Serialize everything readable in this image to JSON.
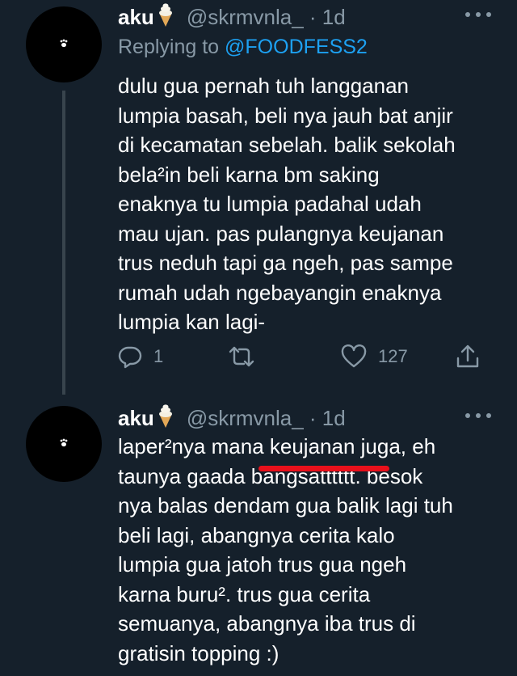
{
  "tweets": [
    {
      "name": "aku",
      "handle": "@skrmvnla_",
      "time": "· 1d",
      "replying_label": "Replying to ",
      "replying_handle": "@FOODFESS2",
      "lines": [
        "dulu gua pernah tuh langganan",
        "lumpia basah, beli nya jauh bat anjir",
        "di kecamatan sebelah. balik sekolah",
        "bela²in beli karna bm saking",
        "enaknya tu lumpia padahal udah",
        "mau ujan. pas pulangnya keujanan",
        "trus neduh tapi ga ngeh, pas sampe",
        "rumah udah ngebayangin enaknya",
        "lumpia kan lagi-"
      ],
      "reply_count": "1",
      "retweet_count": "",
      "like_count": "127"
    },
    {
      "name": "aku",
      "handle": "@skrmvnla_",
      "time": "· 1d",
      "lines": [
        "laper²nya mana keujanan juga, eh",
        "taunya gaada bangsatttttt. besok",
        "nya balas dendam gua balik lagi tuh",
        "beli lagi, abangnya cerita kalo",
        "lumpia gua jatoh trus gua ngeh",
        "karna buru². trus gua cerita",
        "semuanya, abangnya iba trus di",
        "gratisin topping :)"
      ]
    }
  ],
  "icons": {
    "emoji": "soft-ice-cream-icon",
    "more": "more-dots-icon",
    "reply": "reply-icon",
    "retweet": "retweet-icon",
    "like": "heart-icon",
    "share": "share-icon",
    "avatar": "paw-icon"
  },
  "colors": {
    "background": "#15202b",
    "text": "#ffffff",
    "secondary": "#8899a6",
    "link": "#1da1f2",
    "thread_line": "#38444d",
    "redaction": "#e8101b"
  }
}
